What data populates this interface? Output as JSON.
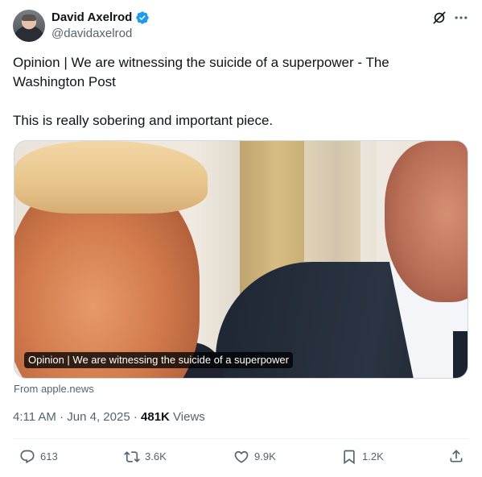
{
  "author": {
    "display_name": "David Axelrod",
    "handle": "@davidaxelrod",
    "verified": true
  },
  "icons": {
    "verified": "verified-badge-icon",
    "grok": "grok-icon",
    "more": "more-icon",
    "reply": "reply-icon",
    "repost": "repost-icon",
    "like": "like-icon",
    "bookmark": "bookmark-icon",
    "share": "share-icon"
  },
  "colors": {
    "verified": "#1d9bf0",
    "text_primary": "#0f1419",
    "text_secondary": "#536471"
  },
  "tweet": {
    "line1": "Opinion | We are witnessing the suicide of a superpower - The Washington Post",
    "line2": "This is really sobering and important piece."
  },
  "card": {
    "title": "Opinion | We are witnessing the suicide of a superpower",
    "source": "From apple.news"
  },
  "meta": {
    "time": "4:11 AM",
    "separator": "·",
    "date": "Jun 4, 2025",
    "views_count": "481K",
    "views_label": "Views"
  },
  "actions": {
    "replies": "613",
    "reposts": "3.6K",
    "likes": "9.9K",
    "bookmarks": "1.2K"
  }
}
